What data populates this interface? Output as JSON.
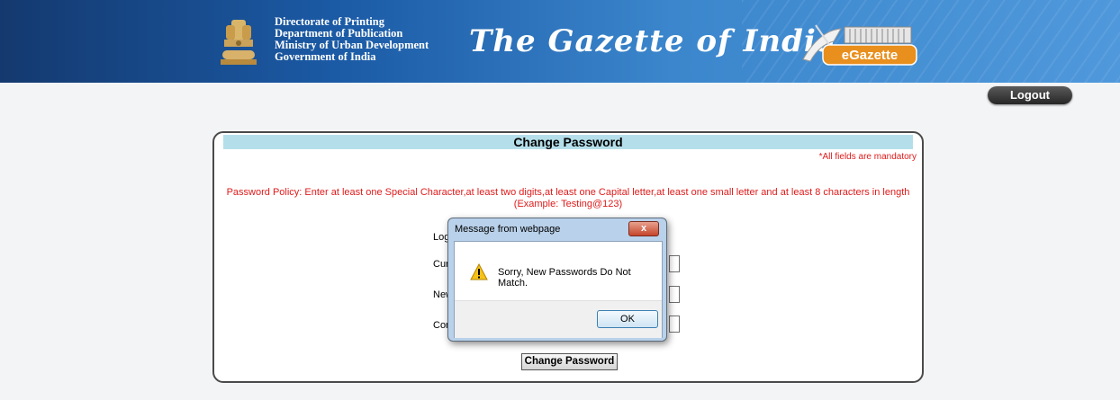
{
  "header": {
    "directorate_lines": [
      "Directorate of Printing",
      "Department of Publication",
      "Ministry of Urban Development",
      "Government of India"
    ],
    "site_title": "The Gazette of India",
    "egazette_logo_text": "eGazette",
    "emblem_icon": "national-emblem-icon"
  },
  "nav": {
    "logout_label": "Logout"
  },
  "form": {
    "title": "Change Password",
    "mandatory_note": "*All fields are mandatory",
    "policy_line1": "Password Policy: Enter at least one Special Character,at least two digits,at least one Capital letter,at least one small letter and at least 8 characters in length",
    "policy_line2": "(Example: Testing@123)",
    "labels": [
      "Log",
      "Cur",
      "New",
      "Con"
    ],
    "submit_label": "Change Password"
  },
  "dialog": {
    "title": "Message from webpage",
    "close_label": "x",
    "message": "Sorry, New Passwords Do Not Match.",
    "ok_label": "OK",
    "icon": "warning-icon"
  }
}
